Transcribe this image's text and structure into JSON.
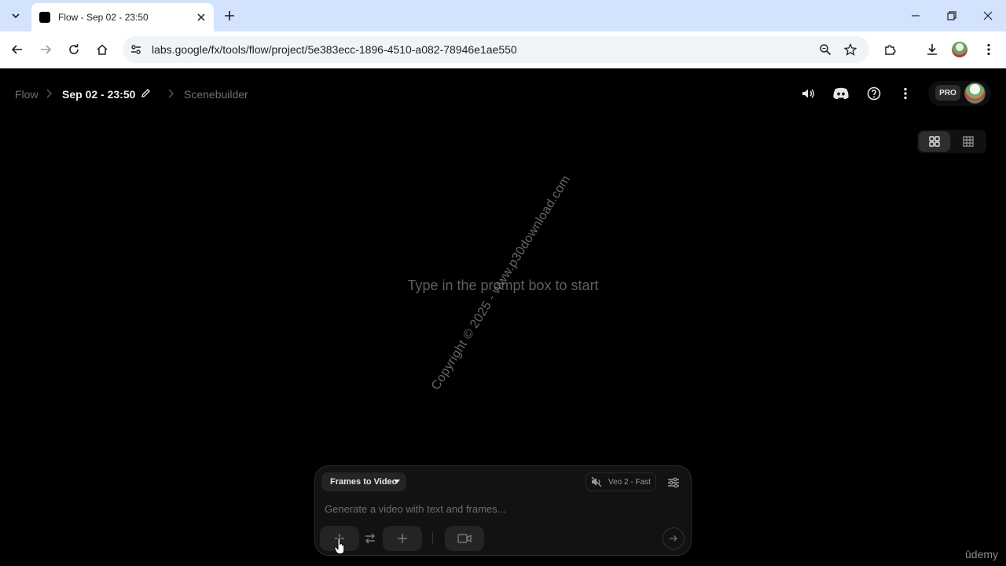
{
  "browser": {
    "tab_title": "Flow - Sep 02 - 23:50",
    "url": "labs.google/fx/tools/flow/project/5e383ecc-1896-4510-a082-78946e1ae550"
  },
  "breadcrumb": {
    "root": "Flow",
    "project": "Sep 02 - 23:50",
    "current": "Scenebuilder"
  },
  "header": {
    "pro_label": "PRO"
  },
  "main": {
    "empty_message": "Type in the prompt box to start",
    "watermark": "Copyright © 2025 - www.p30download.com"
  },
  "prompt": {
    "mode_label": "Frames to Video",
    "model_label": "Veo 2 - Fast",
    "placeholder": "Generate a video with text and frames..."
  },
  "overlay": {
    "brand": "ūdemy"
  },
  "colors": {
    "tab_strip": "#d3e3fd",
    "app_bg": "#000000",
    "prompt_bg": "#121212"
  }
}
